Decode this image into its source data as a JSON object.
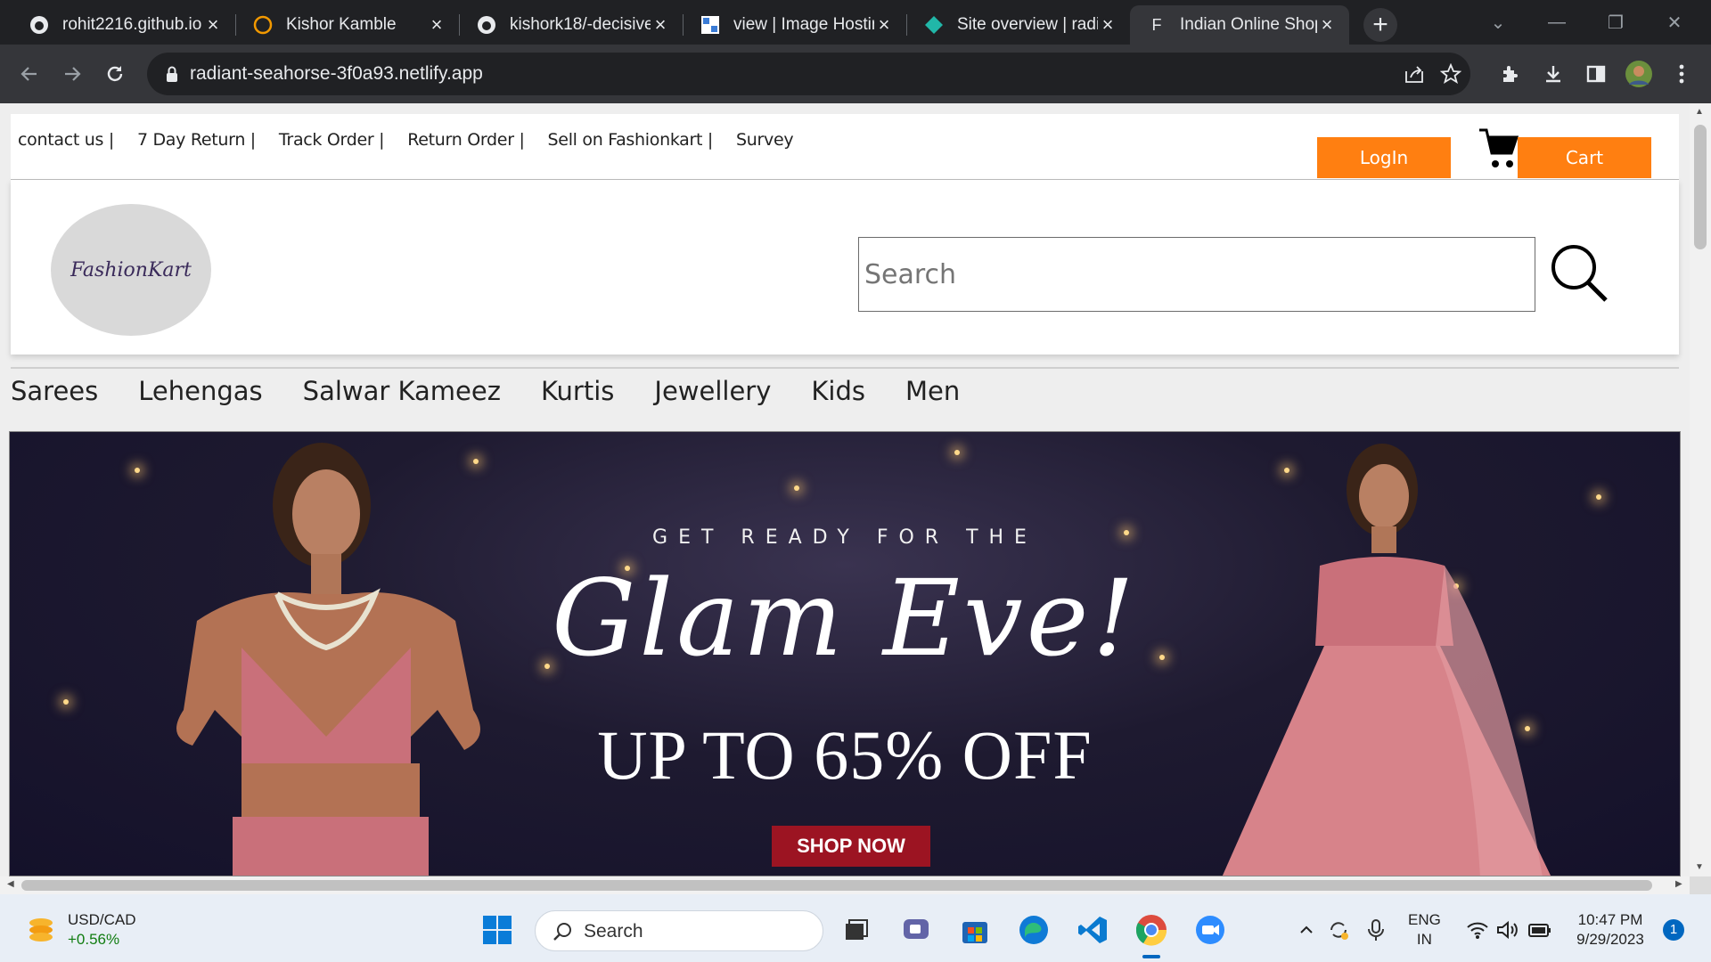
{
  "browser": {
    "tabs": [
      {
        "title": "rohit2216.github.io",
        "icon": "github-icon"
      },
      {
        "title": "Kishor Kamble",
        "icon": "loading-ring-icon"
      },
      {
        "title": "kishork18/-decisive",
        "icon": "github-icon"
      },
      {
        "title": "view | Image Hosting",
        "icon": "image-host-icon"
      },
      {
        "title": "Site overview | radiant",
        "icon": "netlify-icon"
      },
      {
        "title": "Indian Online Shopping",
        "icon": "letter-f-icon",
        "favicon_letter": "F",
        "active": true
      }
    ],
    "address": "radiant-seahorse-3f0a93.netlify.app"
  },
  "site": {
    "top_links": [
      "contact us |",
      "7 Day Return |",
      "Track Order |",
      "Return Order |",
      "Sell on Fashionkart |",
      "Survey"
    ],
    "login_label": "LogIn",
    "cart_label": "Cart",
    "logo_text": "FashionKart",
    "search_placeholder": "Search",
    "categories": [
      "Sarees",
      "Lehengas",
      "Salwar Kameez",
      "Kurtis",
      "Jewellery",
      "Kids",
      "Men"
    ],
    "banner": {
      "line1": "GET READY FOR THE",
      "line2": "Glam Eve!",
      "line3": "UP TO 65% OFF",
      "cta": "SHOP NOW"
    },
    "accent": "#ff7f11"
  },
  "taskbar": {
    "widget_title": "USD/CAD",
    "widget_value": "+0.56%",
    "search_label": "Search",
    "lang_top": "ENG",
    "lang_bottom": "IN",
    "time": "10:47 PM",
    "date": "9/29/2023",
    "notifications": "1"
  }
}
